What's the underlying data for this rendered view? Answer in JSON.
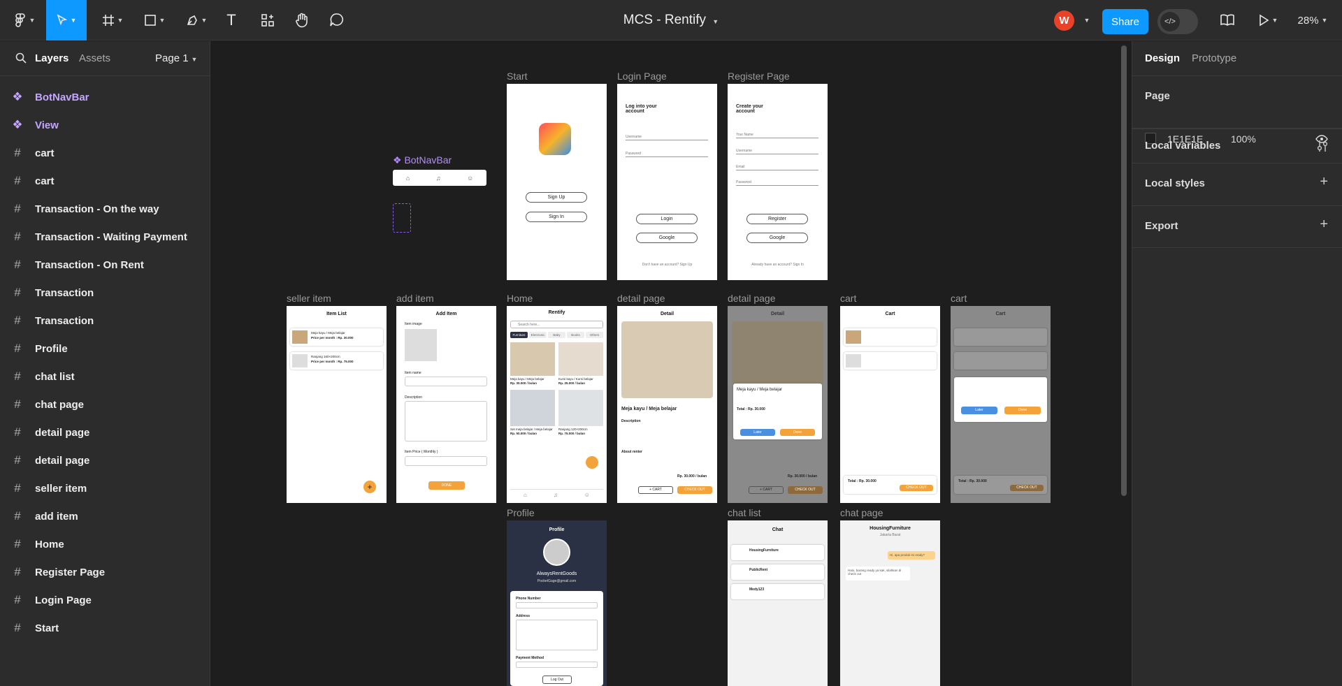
{
  "toolbar": {
    "title": "MCS - Rentify",
    "avatar_initial": "W",
    "share_label": "Share",
    "zoom": "28%",
    "accent": "#0d99ff"
  },
  "left_panel": {
    "tab_layers": "Layers",
    "tab_assets": "Assets",
    "page_selector": "Page 1",
    "layers": [
      {
        "label": "BotNavBar",
        "icon": "component-icon"
      },
      {
        "label": "View",
        "icon": "component-icon"
      },
      {
        "label": "cart",
        "icon": "frame-icon"
      },
      {
        "label": "cart",
        "icon": "frame-icon"
      },
      {
        "label": "Transaction - On the way",
        "icon": "frame-icon"
      },
      {
        "label": "Transaction - Waiting Payment",
        "icon": "frame-icon"
      },
      {
        "label": "Transaction - On Rent",
        "icon": "frame-icon"
      },
      {
        "label": "Transaction",
        "icon": "frame-icon"
      },
      {
        "label": "Transaction",
        "icon": "frame-icon"
      },
      {
        "label": "Profile",
        "icon": "frame-icon"
      },
      {
        "label": "chat list",
        "icon": "frame-icon"
      },
      {
        "label": "chat page",
        "icon": "frame-icon"
      },
      {
        "label": "detail page",
        "icon": "frame-icon"
      },
      {
        "label": "detail page",
        "icon": "frame-icon"
      },
      {
        "label": "seller item",
        "icon": "frame-icon"
      },
      {
        "label": "add item",
        "icon": "frame-icon"
      },
      {
        "label": "Home",
        "icon": "frame-icon"
      },
      {
        "label": "Register Page",
        "icon": "frame-icon"
      },
      {
        "label": "Login Page",
        "icon": "frame-icon"
      },
      {
        "label": "Start",
        "icon": "frame-icon"
      }
    ]
  },
  "right_panel": {
    "tab_design": "Design",
    "tab_prototype": "Prototype",
    "page_heading": "Page",
    "page_color": "1E1E1E",
    "page_opacity": "100%",
    "local_variables": "Local variables",
    "local_styles": "Local styles",
    "export": "Export"
  },
  "canvas": {
    "botnavbar_label": "BotNavBar",
    "frames": {
      "start": {
        "label": "Start",
        "signup": "Sign Up",
        "signin": "Sign In"
      },
      "login": {
        "label": "Login Page",
        "heading": "Log into your account",
        "username": "Username",
        "password": "Password",
        "login_btn": "Login",
        "google_btn": "Google",
        "footer": "Don't have an account? Sign Up"
      },
      "register": {
        "label": "Register Page",
        "heading": "Create your account",
        "name": "Your Name",
        "username": "Username",
        "email": "Email",
        "password": "Password",
        "register_btn": "Register",
        "google_btn": "Google",
        "footer": "Already have an account? Sign In"
      },
      "seller_item": {
        "label": "seller item",
        "title": "Item List",
        "item1": "Meja kayu / Meja belajar",
        "item1_price": "Price per month : Rp. 30.000",
        "item2": "Ranjang 160×200cm",
        "item2_price": "Price per month : Rp. 75.000"
      },
      "add_item": {
        "label": "add item",
        "title": "Add Item",
        "image": "Item image",
        "name": "Item name",
        "description": "Description",
        "price": "Item Price ( Monthly )",
        "done": "DONE"
      },
      "home": {
        "label": "Home",
        "title": "Rentify",
        "search": "Search here...",
        "tabs": [
          "Furniture",
          "Electronic",
          "Baby",
          "Books",
          "Others"
        ],
        "p1": "Meja kayu / Meja belajar",
        "p1_price": "Rp. 30.000 / bulan",
        "p2": "Kursi kayu / Kursi belajar",
        "p2_price": "Rp. 25.000 / bulan",
        "p3": "Set meja belajar / Meja belajar",
        "p3_price": "Rp. 50.000 / bulan",
        "p4": "Ranjang 120×200cm",
        "p4_price": "Rp. 75.000 / bulan"
      },
      "detail1": {
        "label": "detail page",
        "title": "Detail",
        "name": "Meja kayu / Meja belajar",
        "desc_heading": "Description",
        "about": "About renter",
        "price": "Rp. 30.000 / bulan",
        "cart_btn": "+ CART",
        "checkout": "CHECK OUT"
      },
      "detail2": {
        "label": "detail page",
        "title": "Detail",
        "name": "Meja kayu / Meja belajar",
        "total": "Total : Rp. 30.000",
        "later": "Later",
        "done": "Done",
        "price": "Rp. 30.000 / bulan",
        "cart_btn": "+ CART",
        "checkout": "CHECK OUT"
      },
      "cart1": {
        "label": "cart",
        "title": "Cart",
        "total": "Total : Rp. 30.000",
        "checkout": "CHECK OUT"
      },
      "cart2": {
        "label": "cart",
        "title": "Cart",
        "later": "Later",
        "done": "Done",
        "total": "Total : Rp. 30.000",
        "checkout": "CHECK OUT"
      },
      "profile": {
        "label": "Profile",
        "title": "Profile",
        "name": "AlwaysRentGoods",
        "email": "PocketGage@gmail.com",
        "phone": "Phone Number",
        "address": "Address",
        "payment": "Payment Method",
        "logout": "Log Out"
      },
      "chat_list": {
        "label": "chat list",
        "title": "Chat",
        "c1": "HousingFurniture",
        "c2": "PublicRent",
        "c3": "Medy123"
      },
      "chat_page": {
        "label": "chat page",
        "title": "HousingFurniture",
        "subtitle": "Jakarta Barat",
        "msg1": "Hi, apa produk ini ready?",
        "msg2": "Halo, barang ready ya kak, silahkan di check out"
      }
    }
  }
}
